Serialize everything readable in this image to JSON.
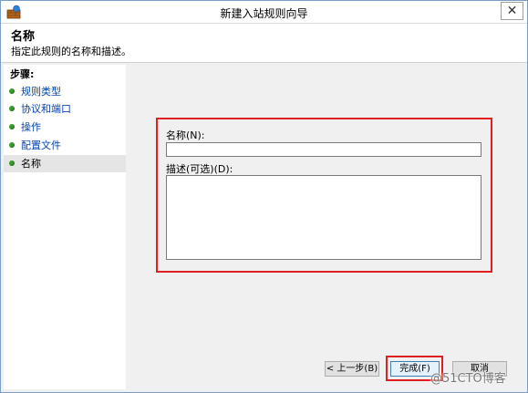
{
  "window": {
    "title": "新建入站规则向导",
    "close_symbol": "✕"
  },
  "header": {
    "title": "名称",
    "description": "指定此规则的名称和描述。"
  },
  "sidebar": {
    "steps_label": "步骤:",
    "items": [
      {
        "label": "规则类型",
        "active": false
      },
      {
        "label": "协议和端口",
        "active": false
      },
      {
        "label": "操作",
        "active": false
      },
      {
        "label": "配置文件",
        "active": false
      },
      {
        "label": "名称",
        "active": true
      }
    ]
  },
  "form": {
    "name_label": "名称(N):",
    "name_value": "",
    "description_label": "描述(可选)(D):",
    "description_value": ""
  },
  "buttons": {
    "prev_label": "< 上一步(B)",
    "finish_label": "完成(F)",
    "cancel_label": "取消"
  },
  "watermark": "@51CTO博客",
  "colors": {
    "highlight": "#e02020",
    "bullet": "#3a9a2b"
  }
}
